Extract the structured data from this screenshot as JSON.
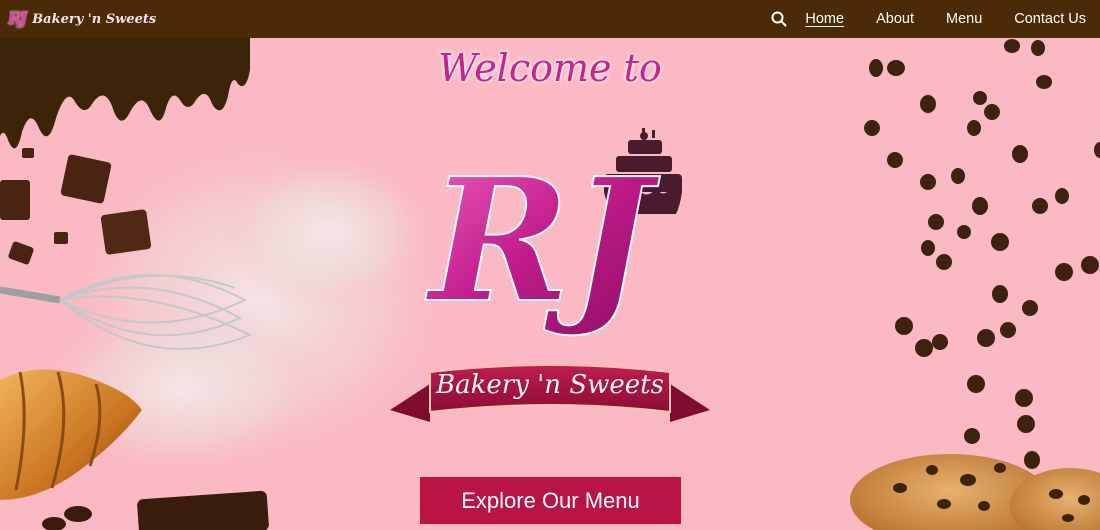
{
  "nav": {
    "brand_mark": "RJ",
    "brand_name": "Bakery 'n Sweets",
    "search_icon": "search-icon",
    "links": [
      {
        "label": "Home",
        "active": true
      },
      {
        "label": "About",
        "active": false
      },
      {
        "label": "Menu",
        "active": false
      },
      {
        "label": "Contact Us",
        "active": false
      }
    ]
  },
  "hero": {
    "welcome": "Welcome to",
    "logo_monogram": "RJ",
    "logo_banner": "Bakery 'n Sweets",
    "cta_label": "Explore Our Menu"
  },
  "colors": {
    "background": "#fbb9c3",
    "navbar": "#4a2a07",
    "accent": "#cf1f8c",
    "cta": "#b81446"
  }
}
